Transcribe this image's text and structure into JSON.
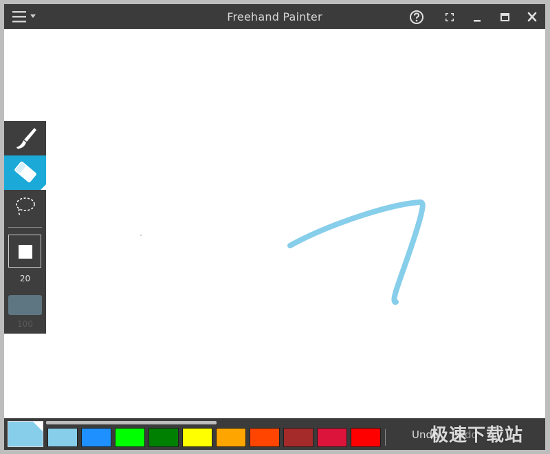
{
  "window": {
    "title": "Freehand Painter"
  },
  "titlebar": {
    "menu_icon": "hamburger-menu-icon",
    "help_icon": "question-circle-icon",
    "fullscreen_icon": "fullscreen-arrows-icon",
    "minimize_icon": "minimize-icon",
    "maximize_icon": "maximize-icon",
    "close_icon": "close-icon"
  },
  "tools": {
    "items": [
      {
        "name": "brush",
        "icon": "brush-icon",
        "active": false
      },
      {
        "name": "eraser",
        "icon": "eraser-icon",
        "active": true
      },
      {
        "name": "lasso",
        "icon": "lasso-select-icon",
        "active": false
      }
    ],
    "brush_size": "20",
    "opacity": "100",
    "active_accent": "#1ba9d8"
  },
  "palette": {
    "current_color": "#87ceeb",
    "swatches": [
      "#87ceeb",
      "#1e90ff",
      "#00ff00",
      "#008000",
      "#ffff00",
      "#ffa500",
      "#ff4500",
      "#a52a2a",
      "#dc143c",
      "#ff0000"
    ],
    "undo_label": "Undo",
    "redo_label": "Redo"
  },
  "canvas": {
    "background": "#ffffff",
    "stroke_color": "#87ceeb"
  },
  "watermark": {
    "text": "极速下载站"
  }
}
